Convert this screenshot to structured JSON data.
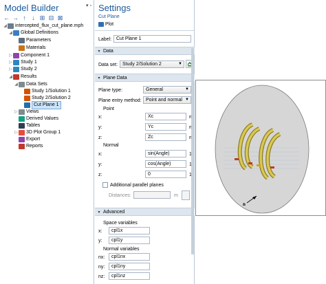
{
  "model_builder": {
    "title": "Model Builder",
    "ctrl_glyphs": "▾ ▫",
    "toolbar": [
      {
        "name": "arrow-left-icon",
        "glyph": "←"
      },
      {
        "name": "arrow-right-icon",
        "glyph": "→"
      },
      {
        "name": "arrow-up-icon",
        "glyph": "↑"
      },
      {
        "name": "arrow-down-icon",
        "glyph": "↓"
      },
      {
        "name": "show-icon",
        "glyph": "⊞"
      },
      {
        "name": "collapse-icon",
        "glyph": "⊟"
      },
      {
        "name": "expand-icon",
        "glyph": "⊠"
      }
    ],
    "tree": [
      {
        "label": "intercepted_flux_cut_plane.mph",
        "icon": "mph-file-icon",
        "color": "#6b7d8f",
        "twisty": "◢",
        "indent": 0
      },
      {
        "label": "Global Definitions",
        "icon": "globe-icon",
        "color": "#3b7dc4",
        "twisty": "◢",
        "indent": 1
      },
      {
        "label": "Parameters",
        "icon": "parameters-icon",
        "color": "#5d6d7e",
        "twisty": "",
        "indent": 2
      },
      {
        "label": "Materials",
        "icon": "materials-icon",
        "color": "#c8741a",
        "twisty": "",
        "indent": 2
      },
      {
        "label": "Component 1",
        "icon": "component-icon",
        "color": "#8e44ad",
        "twisty": "▷",
        "indent": 1
      },
      {
        "label": "Study 1",
        "icon": "study-icon",
        "color": "#2e86c1",
        "twisty": "▷",
        "indent": 1
      },
      {
        "label": "Study 2",
        "icon": "study-icon",
        "color": "#2e86c1",
        "twisty": "▷",
        "indent": 1
      },
      {
        "label": "Results",
        "icon": "results-icon",
        "color": "#c0392b",
        "twisty": "◢",
        "indent": 1
      },
      {
        "label": "Data Sets",
        "icon": "datasets-icon",
        "color": "#7f8c8d",
        "twisty": "◢",
        "indent": 2
      },
      {
        "label": "Study 1/Solution 1",
        "icon": "solution-icon",
        "color": "#d35400",
        "twisty": "",
        "indent": 3
      },
      {
        "label": "Study 2/Solution 2",
        "icon": "solution-icon",
        "color": "#d35400",
        "twisty": "",
        "indent": 3
      },
      {
        "label": "Cut Plane 1",
        "icon": "cut-plane-icon",
        "color": "#1f6fb2",
        "twisty": "",
        "indent": 3,
        "selected": true
      },
      {
        "label": "Views",
        "icon": "views-icon",
        "color": "#7f8c8d",
        "twisty": "▷",
        "indent": 2
      },
      {
        "label": "Derived Values",
        "icon": "derived-values-icon",
        "color": "#16a085",
        "twisty": "",
        "indent": 2
      },
      {
        "label": "Tables",
        "icon": "tables-icon",
        "color": "#2c3e50",
        "twisty": "",
        "indent": 2
      },
      {
        "label": "3D Plot Group 1",
        "icon": "plot-group-icon",
        "color": "#e74c3c",
        "twisty": "▷",
        "indent": 2
      },
      {
        "label": "Export",
        "icon": "export-icon",
        "color": "#8e44ad",
        "twisty": "",
        "indent": 2
      },
      {
        "label": "Reports",
        "icon": "reports-icon",
        "color": "#c0392b",
        "twisty": "",
        "indent": 2
      }
    ]
  },
  "settings": {
    "title": "Settings",
    "subtitle": "Cut Plane",
    "plot_label": "Plot",
    "label_field": {
      "label": "Label:",
      "value": "Cut Plane 1"
    },
    "data_section": "Data",
    "data_set": {
      "label": "Data set:",
      "value": "Study 2/Solution 2"
    },
    "plane_section": "Plane Data",
    "plane_type": {
      "label": "Plane type:",
      "value": "General"
    },
    "plane_entry": {
      "label": "Plane entry method:",
      "value": "Point and normal"
    },
    "point_label": "Point",
    "point": [
      {
        "axis": "x:",
        "value": "Xc",
        "unit": "m"
      },
      {
        "axis": "y:",
        "value": "Yc",
        "unit": "m"
      },
      {
        "axis": "z:",
        "value": "Zc",
        "unit": "m"
      }
    ],
    "normal_label": "Normal",
    "normal": [
      {
        "axis": "x:",
        "value": "sin(Angle)",
        "unit": "1"
      },
      {
        "axis": "y:",
        "value": "cos(Angle)",
        "unit": "1"
      },
      {
        "axis": "z:",
        "value": "0",
        "unit": "1"
      }
    ],
    "additional_planes": "Additional parallel planes",
    "distances_label": "Distances:",
    "distances_unit": "m",
    "advanced_section": "Advanced",
    "space_vars_label": "Space variables",
    "space_vars": [
      {
        "axis": "x:",
        "value": "cpl1x"
      },
      {
        "axis": "y:",
        "value": "cpl1y"
      }
    ],
    "normal_vars_label": "Normal variables",
    "normal_vars": [
      {
        "axis": "nx:",
        "value": "cpl1nx"
      },
      {
        "axis": "ny:",
        "value": "cpl1ny"
      },
      {
        "axis": "nz:",
        "value": "cpl1nz"
      }
    ]
  },
  "graphics": {
    "normal_marker": "n",
    "plane_color": "#d6d6d6",
    "coil_color": "#c8b84a"
  }
}
